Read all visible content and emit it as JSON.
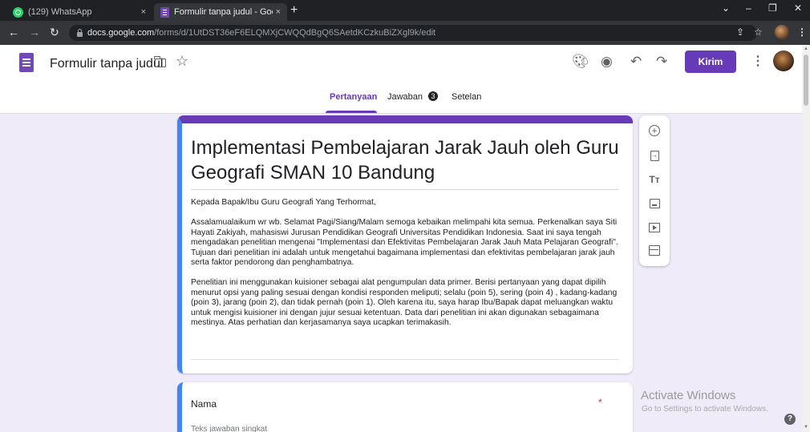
{
  "browser": {
    "tabs": [
      {
        "title": "(129) WhatsApp",
        "close": "×"
      },
      {
        "title": "Formulir tanpa judul - Google Fo",
        "close": "×"
      }
    ],
    "new_tab": "+",
    "window_controls": {
      "minimize": "–",
      "maximize": "❐",
      "close": "✕",
      "menu": "⌄"
    },
    "url_host": "docs.google.com",
    "url_path": "/forms/d/1UtDST36eF6ELQMXjCWQQdBgQ6SAetdKCzkuBiZXgl9k/edit"
  },
  "header": {
    "doc_title": "Formulir tanpa judul",
    "send_label": "Kirim",
    "tabs": [
      {
        "label": "Pertanyaan"
      },
      {
        "label": "Jawaban"
      },
      {
        "label": "Setelan"
      }
    ],
    "responses_count": "3",
    "accent_color": "#673ab7"
  },
  "form": {
    "title": "Implementasi Pembelajaran Jarak Jauh oleh Guru Geografi SMAN 10 Bandung",
    "description_greeting": "Kepada Bapak/Ibu Guru Geografi Yang Terhormat,",
    "description_p1": "Assalamualaikum wr wb. Selamat Pagi/Siang/Malam semoga kebaikan melimpahi kita semua. Perkenalkan saya Siti Hayati Zakiyah, mahasiswi Jurusan Pendidikan Geografi Universitas Pendidikan Indonesia. Saat ini saya tengah mengadakan penelitian mengenai \"Implementasi dan Efektivitas Pembelajaran Jarak Jauh Mata Pelajaran Geografi\". Tujuan dari penelitian ini adalah untuk mengetahui bagaimana implementasi dan efektivitas pembelajaran jarak jauh serta faktor pendorong dan penghambatnya.",
    "description_p2": "Penelitian ini menggunakan kuisioner sebagai alat pengumpulan data primer. Berisi pertanyaan yang dapat dipilih menurut opsi yang paling sesuai dengan kondisi responden meliputi; selalu (poin 5), sering (poin 4) , kadang-kadang (poin 3), jarang (poin 2), dan tidak pernah (poin 1). Oleh karena itu, saya harap Ibu/Bapak dapat meluangkan waktu untuk mengisi kuisioner ini dengan jujur sesuai ketentuan. Data dari penelitian ini akan digunakan sebagaimana mestinya. Atas perhatian dan kerjasamanya saya ucapkan terimakasih.",
    "question": {
      "label": "Nama",
      "required_mark": "*",
      "placeholder": "Teks jawaban singkat"
    }
  },
  "toolbar": {
    "text_icon_glyph": "Tт"
  },
  "watermark": {
    "title": "Activate Windows",
    "subtitle": "Go to Settings to activate Windows."
  },
  "help": "?"
}
